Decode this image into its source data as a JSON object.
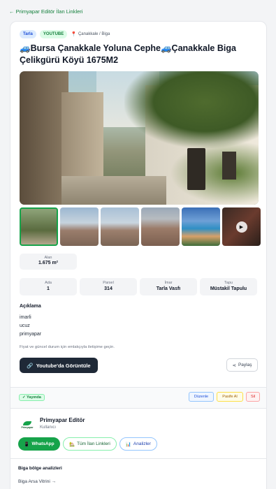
{
  "nav": {
    "back_label": "← Primyapar Editör İlan Linkleri"
  },
  "listing": {
    "tags": {
      "type": "Tarla",
      "source": "YOUTUBE",
      "location": "Çanakkale / Biga"
    },
    "title": "🚙Bursa Çanakkale Yoluna Cephe🚙Çanakkale Biga Çelikgürü Köyü 1675M2",
    "area": {
      "label": "Alan",
      "value": "1.675 m²"
    },
    "stats": [
      {
        "label": "Ada",
        "value": "1"
      },
      {
        "label": "Parsel",
        "value": "314"
      },
      {
        "label": "İmar",
        "value": "Tarla Vasfı"
      },
      {
        "label": "Tapu",
        "value": "Müstakil Tapulu"
      }
    ],
    "description": {
      "heading": "Açıklama",
      "lines": [
        "imarli",
        "ucuz",
        "primyapar"
      ]
    },
    "note": "Fiyat ve güncel durum için emlakçıyla iletişime geçin.",
    "youtube_button": "Youtube'da Görüntüle",
    "share_button": "Paylaş"
  },
  "status": {
    "live_badge": "Yayında",
    "edit_button": "Düzenle",
    "passive_button": "Pasife Al",
    "delete_button": "Sil"
  },
  "editor": {
    "logo_text": "Primyapar",
    "name": "Primyapar Editör",
    "role": "Kullanıcı",
    "whatsapp_button": "WhatsApp",
    "all_links_button": "Tüm İlan Linkleri",
    "analytics_button": "Analizler"
  },
  "region": {
    "title": "Biga bölge analizleri",
    "link": "Biga Arsa Vitrini →"
  },
  "colors": {
    "accent_green": "#16a34a",
    "dark_button": "#1f2937"
  },
  "icons": [
    "pin-icon",
    "youtube-icon",
    "share-icon",
    "check-icon",
    "whatsapp-icon",
    "house-icon",
    "chart-icon",
    "play-icon"
  ]
}
